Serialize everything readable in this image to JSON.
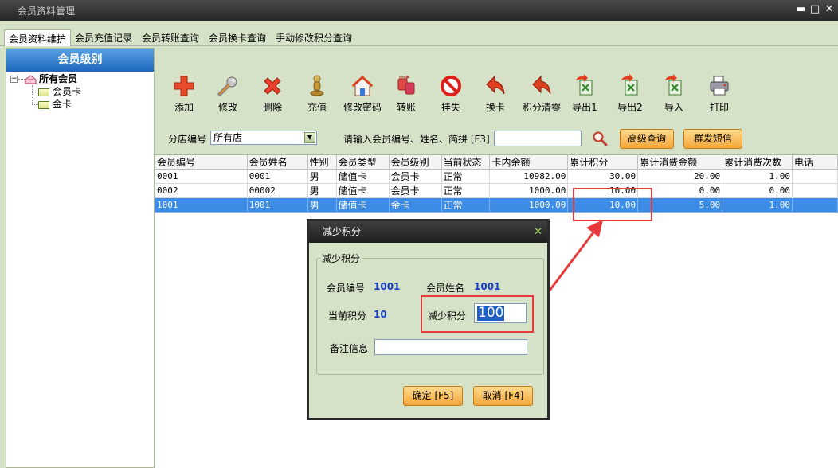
{
  "window": {
    "title": "会员资料管理",
    "min_glyph": "▬",
    "max_glyph": "□",
    "close_glyph": "✕"
  },
  "tabs": [
    {
      "label": "会员资料维护",
      "active": true
    },
    {
      "label": "会员充值记录",
      "active": false
    },
    {
      "label": "会员转账查询",
      "active": false
    },
    {
      "label": "会员换卡查询",
      "active": false
    },
    {
      "label": "手动修改积分查询",
      "active": false
    }
  ],
  "sidebar": {
    "title": "会员级别",
    "root": "所有会员",
    "children": [
      "会员卡",
      "金卡"
    ]
  },
  "toolbar": [
    {
      "label": "添加",
      "icon": "add-icon"
    },
    {
      "label": "修改",
      "icon": "wrench-icon"
    },
    {
      "label": "删除",
      "icon": "delete-icon"
    },
    {
      "label": "充值",
      "icon": "recharge-icon"
    },
    {
      "label": "修改密码",
      "icon": "house-key-icon"
    },
    {
      "label": "转账",
      "icon": "transfer-icon"
    },
    {
      "label": "挂失",
      "icon": "no-entry-icon"
    },
    {
      "label": "换卡",
      "icon": "swap-card-icon"
    },
    {
      "label": "积分清零",
      "icon": "clear-points-icon"
    },
    {
      "label": "导出1",
      "icon": "export-icon"
    },
    {
      "label": "导出2",
      "icon": "export-icon"
    },
    {
      "label": "导入",
      "icon": "import-icon"
    },
    {
      "label": "打印",
      "icon": "printer-icon"
    }
  ],
  "filter": {
    "store_label": "分店编号",
    "store_value": "所有店",
    "search_prompt": "请输入会员编号、姓名、简拼 [F3]",
    "search_value": "",
    "advanced_button": "高级查询",
    "sms_button": "群发短信"
  },
  "grid": {
    "columns": [
      "会员编号",
      "会员姓名",
      "性别",
      "会员类型",
      "会员级别",
      "当前状态",
      "卡内余额",
      "累计积分",
      "累计消费金额",
      "累计消费次数",
      "电话"
    ],
    "rows": [
      [
        "0001",
        "0001",
        "男",
        "储值卡",
        "会员卡",
        "正常",
        "10982.00",
        "30.00",
        "20.00",
        "1.00",
        ""
      ],
      [
        "0002",
        "00002",
        "男",
        "储值卡",
        "会员卡",
        "正常",
        "1000.00",
        "10.00",
        "0.00",
        "0.00",
        ""
      ],
      [
        "1001",
        "1001",
        "男",
        "储值卡",
        "金卡",
        "正常",
        "1000.00",
        "10.00",
        "5.00",
        "1.00",
        ""
      ]
    ],
    "selected_row": 2
  },
  "dialog": {
    "title": "减少积分",
    "close_glyph": "✕",
    "group_title": "减少积分",
    "member_no_label": "会员编号",
    "member_no_value": "1001",
    "member_name_label": "会员姓名",
    "member_name_value": "1001",
    "current_points_label": "当前积分",
    "current_points_value": "10",
    "reduce_label": "减少积分",
    "reduce_value": "100",
    "remark_label": "备注信息",
    "remark_value": "",
    "ok_button": "确定 [F5]",
    "cancel_button": "取消 [F4]"
  },
  "colors": {
    "accent": "#f3a73b",
    "highlight": "#e83a3a",
    "selection": "#3c8ce6",
    "value_blue": "#1740c0"
  }
}
